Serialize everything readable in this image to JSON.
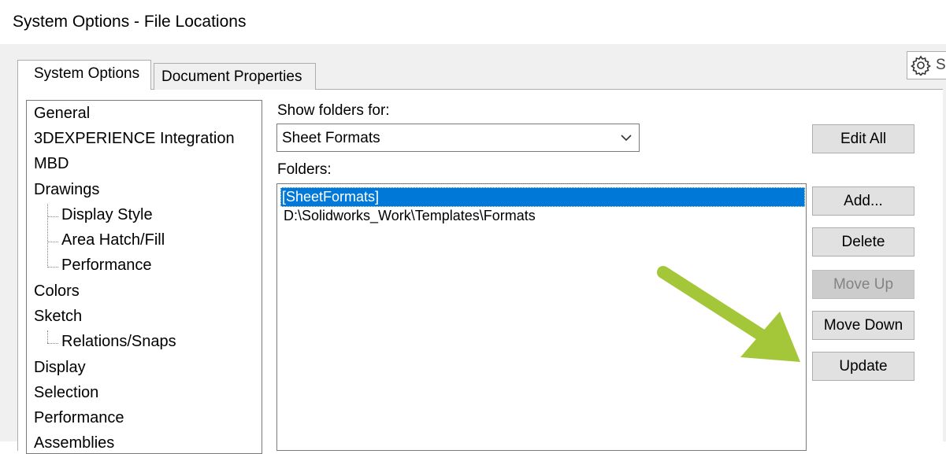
{
  "window": {
    "title": "System Options - File Locations"
  },
  "tabs": [
    {
      "label": "System Options",
      "active": true
    },
    {
      "label": "Document Properties",
      "active": false
    }
  ],
  "settings_button": {
    "label": "S",
    "icon": "gear-icon"
  },
  "tree": {
    "items": [
      {
        "label": "General",
        "level": 0
      },
      {
        "label": "3DEXPERIENCE Integration",
        "level": 0
      },
      {
        "label": "MBD",
        "level": 0
      },
      {
        "label": "Drawings",
        "level": 0
      },
      {
        "label": "Display Style",
        "level": 1
      },
      {
        "label": "Area Hatch/Fill",
        "level": 1
      },
      {
        "label": "Performance",
        "level": 1
      },
      {
        "label": "Colors",
        "level": 0
      },
      {
        "label": "Sketch",
        "level": 0
      },
      {
        "label": "Relations/Snaps",
        "level": 1
      },
      {
        "label": "Display",
        "level": 0
      },
      {
        "label": "Selection",
        "level": 0
      },
      {
        "label": "Performance",
        "level": 0
      },
      {
        "label": "Assemblies",
        "level": 0
      }
    ]
  },
  "show_folders_for": {
    "label": "Show folders for:",
    "selected": "Sheet Formats"
  },
  "folders": {
    "label": "Folders:",
    "items": [
      {
        "path": "[SheetFormats]",
        "selected": true
      },
      {
        "path": "D:\\Solidworks_Work\\Templates\\Formats",
        "selected": false
      }
    ]
  },
  "buttons": {
    "edit_all": "Edit All",
    "add": "Add...",
    "delete": "Delete",
    "move_up": "Move Up",
    "move_down": "Move Down",
    "update": "Update"
  },
  "colors": {
    "selection": "#0078d7",
    "annotation_arrow": "#a4c639"
  }
}
